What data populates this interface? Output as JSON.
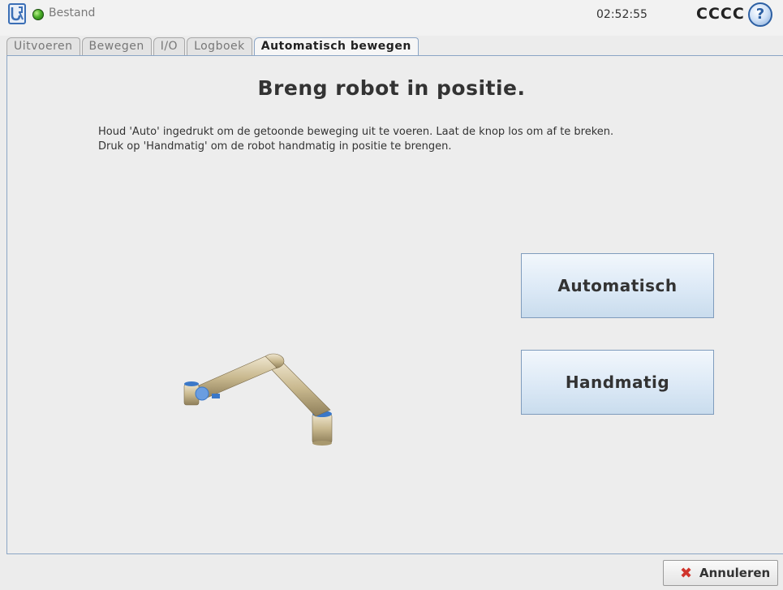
{
  "header": {
    "menu_file": "Bestand",
    "clock": "02:52:55",
    "robot_name": "CCCC",
    "help_glyph": "?",
    "status_color": "#4caf2a"
  },
  "tabs": [
    {
      "label": "Uitvoeren",
      "active": false
    },
    {
      "label": "Bewegen",
      "active": false
    },
    {
      "label": "I/O",
      "active": false
    },
    {
      "label": "Logboek",
      "active": false
    },
    {
      "label": "Automatisch bewegen",
      "active": true
    }
  ],
  "main": {
    "title": "Breng robot in positie.",
    "instructions": [
      "Houd 'Auto' ingedrukt om de getoonde beweging uit te voeren. Laat de knop los om af te breken.",
      "Druk op 'Handmatig' om de robot handmatig in positie te brengen."
    ],
    "auto_button": "Automatisch",
    "manual_button": "Handmatig"
  },
  "footer": {
    "cancel_label": "Annuleren",
    "cancel_icon": "close-icon"
  },
  "colors": {
    "accent": "#8ba5c5",
    "button_top": "#f2f7fc",
    "button_bottom": "#c9dced",
    "cancel_icon": "#d0342c"
  }
}
